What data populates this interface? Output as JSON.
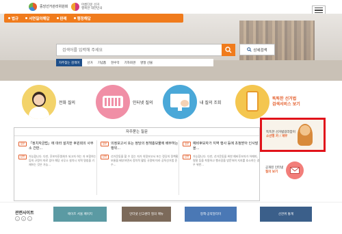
{
  "header": {
    "logo1_line1": "중앙선거관리위원회",
    "logo1_line2": "",
    "logo2_line1": "아름다운 선거",
    "logo2_line2": "행복한 대한민국",
    "menu_label": "사이트맵"
  },
  "nav": {
    "items": [
      "법규",
      "서면질의해답",
      "판례",
      "행정해답"
    ]
  },
  "search": {
    "placeholder": "검색어를 입력해 주세요",
    "detail_label": "상세검색",
    "hot_label": "자주찾는 검색어",
    "hot_terms": [
      "선거",
      "기념품",
      "현수막",
      "기자회견",
      "명절 선물"
    ]
  },
  "services": [
    {
      "label": "전화 질의",
      "color": "#f3d36a"
    },
    {
      "label": "인터넷 질의",
      "color": "#f08fa6"
    },
    {
      "label": "내 질의 조회",
      "color": "#4aa8d8"
    },
    {
      "label_top": "똑똑한 선거법",
      "label_bottom": "검색서비스 보기",
      "color": "#f4c64f"
    }
  ],
  "faq": {
    "title": "자주묻는 질문",
    "columns": [
      {
        "q": "「정치자금법」에 따라 설치한 후원회의 사무소 간판...",
        "a": "가능합니다. 다만, 후보자후원회가 되고자 하는 자 포함하는 등의 규정이 따로 있어 해당 사무소 설치시 지역 명칭을 기재하는 것은 가능..."
      },
      {
        "q": "의정보고서 또는 정당의 정책홍보물에 배부하는 행위...",
        "a": "선거운동을 할 수 있는 자가 의정보고서 또는 정당의 정책홍보물을 배부하면서 정치적 활동 규정에 따라 공직선거법 준수..."
      },
      {
        "q": "예비후보자가 지역 행사 등에 초청받아 인사말을...",
        "a": "가능합니다. 다만, 선거운동을 위한 예비후보자가 어깨띠, 명찰 등을 착용하고 행사장을 방문하여 지지를 호소하는 경우 위반..."
      }
    ]
  },
  "side": {
    "box1_line1": "똑똑한 선거법길라잡이",
    "box1_line2": "소년행 카 /  게부",
    "box2_line1": "공개된 인터넷",
    "box2_line2": "질의 보기"
  },
  "related": {
    "label": "관련사이트",
    "pager": [
      "<",
      "II",
      ">"
    ],
    "banners": [
      {
        "label": "에이즈 서울 페이지",
        "color": "#5b9aa3"
      },
      {
        "label": "인터넷 신고센터 질의 메뉴",
        "color": "#7c6a5a"
      },
      {
        "label": "정책·공약알리미",
        "color": "#4a78b5"
      },
      {
        "label": "선관위 통계",
        "color": "#3b5f8a"
      }
    ]
  },
  "colors": {
    "accent": "#f07b1c",
    "highlight": "#e1121a",
    "navy": "#1e4f8a"
  }
}
